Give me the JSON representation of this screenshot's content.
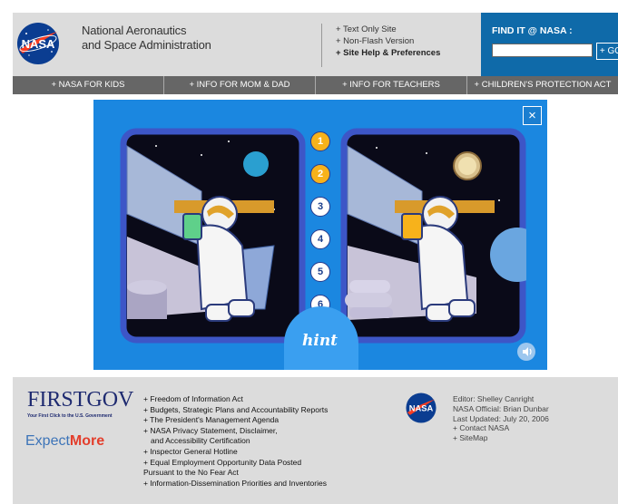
{
  "header": {
    "agency_line1": "National Aeronautics",
    "agency_line2": "and Space Administration",
    "logo_text": "NASA",
    "quick_links": [
      "+ Text Only Site",
      "+ Non-Flash Version",
      "+ Site Help & Preferences"
    ],
    "findit_title": "FIND IT @ NASA :",
    "search_value": "",
    "go_label": "+ GO"
  },
  "nav": {
    "items": [
      "+ NASA FOR KIDS",
      "+ INFO FOR MOM & DAD",
      "+ INFO FOR TEACHERS",
      "+ CHILDREN'S PROTECTION ACT"
    ]
  },
  "game": {
    "close_label": "×",
    "numbers": [
      "1",
      "2",
      "3",
      "4",
      "5",
      "6"
    ],
    "found": [
      true,
      true,
      false,
      false,
      false,
      false
    ],
    "hint_label": "hint",
    "colors": {
      "background": "#1b87e0",
      "found": "#f7b21b",
      "frame": "#3d56c7"
    }
  },
  "footer": {
    "firstgov": "FIRSTGOV",
    "firstgov_tagline": "Your First Click to the U.S. Government",
    "expectmore_a": "Expect",
    "expectmore_b": "More",
    "links": [
      "+ Freedom of Information Act",
      "+ Budgets, Strategic Plans and Accountability Reports",
      "+ The President's Management Agenda",
      "+ NASA Privacy Statement, Disclaimer,",
      "   and Accessibility Certification",
      "+ Inspector General Hotline",
      "+ Equal Employment Opportunity Data Posted",
      "Pursuant to the No Fear Act",
      "+ Information-Dissemination Priorities and Inventories"
    ],
    "editor": [
      "Editor: Shelley Canright",
      "NASA Official: Brian Dunbar",
      "Last Updated: July 20, 2006",
      "+ Contact NASA",
      "+ SiteMap"
    ]
  }
}
